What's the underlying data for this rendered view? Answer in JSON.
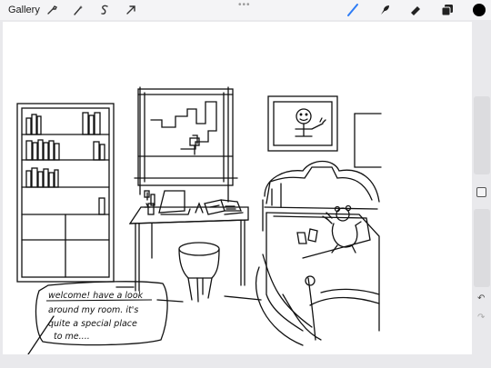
{
  "topbar": {
    "gallery_label": "Gallery",
    "left_tools": [
      "wrench-icon",
      "magic-wand-icon",
      "selection-icon",
      "transform-icon"
    ],
    "right_tools": [
      "brush-icon",
      "smudge-icon",
      "eraser-icon",
      "layers-icon",
      "color-swatch"
    ],
    "active_tool": "brush-icon",
    "accent_color": "#2d7cf6",
    "current_color": "#000000"
  },
  "sidebar": {
    "items": [
      "brush-size-slider",
      "modify-button",
      "opacity-slider",
      "undo-icon",
      "redo-icon"
    ],
    "undo_symbol": "↶",
    "redo_symbol": "↷"
  },
  "canvas": {
    "handwritten_note": [
      "welcome! have a look",
      "around my room. it's",
      "quite a special place",
      "to me...."
    ]
  }
}
